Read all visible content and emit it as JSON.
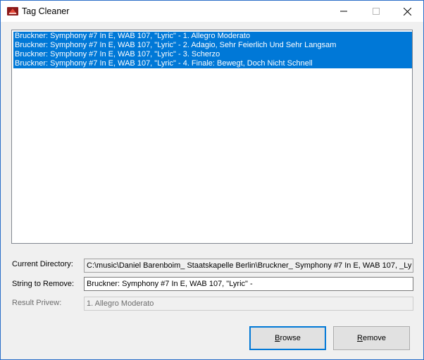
{
  "window": {
    "title": "Tag Cleaner",
    "icon": "app-icon",
    "controls": [
      "minimize-icon",
      "maximize-icon",
      "close-icon"
    ]
  },
  "file_list": {
    "items": [
      "Bruckner: Symphony #7 In E, WAB 107, \"Lyric\" - 1. Allegro Moderato",
      "Bruckner: Symphony #7 In E, WAB 107, \"Lyric\" - 2. Adagio, Sehr Feierlich Und Sehr Langsam",
      "Bruckner: Symphony #7 In E, WAB 107, \"Lyric\" - 3. Scherzo",
      "Bruckner: Symphony #7 In E, WAB 107, \"Lyric\" - 4. Finale: Bewegt, Doch Nicht Schnell"
    ],
    "selection_color": "#0078d7"
  },
  "fields": {
    "current_directory": {
      "label": "Current Directory:",
      "value": "C:\\music\\Daniel Barenboim_ Staatskapelle Berlin\\Bruckner_ Symphony #7 In E, WAB 107, _Ly"
    },
    "string_to_remove": {
      "label": "String to Remove:",
      "value": "Bruckner: Symphony #7 In E, WAB 107, \"Lyric\" -"
    },
    "result_preview": {
      "label": "Result Privew:",
      "value": "1. Allegro Moderato"
    }
  },
  "buttons": {
    "browse": {
      "accel": "B",
      "rest": "rowse"
    },
    "remove": {
      "accel": "R",
      "rest": "emove"
    }
  }
}
